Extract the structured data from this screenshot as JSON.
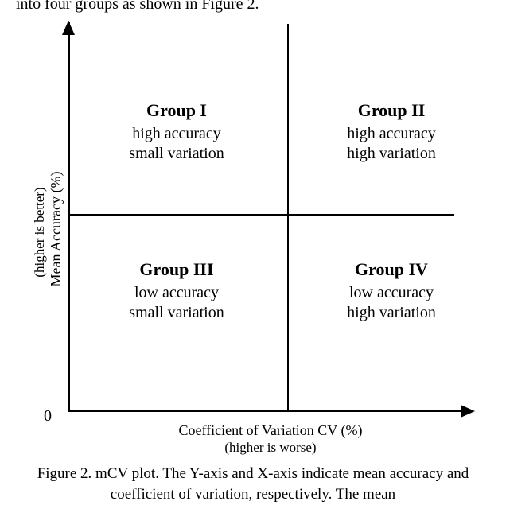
{
  "prev_text_fragment": "into four groups as shown in Figure 2.",
  "origin_label": "0",
  "axes": {
    "y": {
      "label": "Mean Accuracy (%)",
      "sublabel": "(higher is better)"
    },
    "x": {
      "label": "Coefficient of Variation CV (%)",
      "sublabel": "(higher is worse)"
    }
  },
  "quadrants": {
    "q1": {
      "title": "Group I",
      "line1": "high accuracy",
      "line2": "small variation"
    },
    "q2": {
      "title": "Group II",
      "line1": "high accuracy",
      "line2": "high variation"
    },
    "q3": {
      "title": "Group III",
      "line1": "low accuracy",
      "line2": "small variation"
    },
    "q4": {
      "title": "Group IV",
      "line1": "low accuracy",
      "line2": "high variation"
    }
  },
  "caption": "Figure 2.  mCV plot. The Y-axis and X-axis indicate mean accuracy and coefficient of variation, respectively. The mean",
  "chart_data": {
    "type": "table",
    "description": "2x2 quadrant classification diagram (mCV plot)",
    "x_dimension": "Coefficient of Variation CV (%) — higher is worse",
    "y_dimension": "Mean Accuracy (%) — higher is better",
    "cells": [
      {
        "group": "Group I",
        "x": "small variation",
        "y": "high accuracy",
        "position": "top-left"
      },
      {
        "group": "Group II",
        "x": "high variation",
        "y": "high accuracy",
        "position": "top-right"
      },
      {
        "group": "Group III",
        "x": "small variation",
        "y": "low accuracy",
        "position": "bottom-left"
      },
      {
        "group": "Group IV",
        "x": "high variation",
        "y": "low accuracy",
        "position": "bottom-right"
      }
    ]
  }
}
